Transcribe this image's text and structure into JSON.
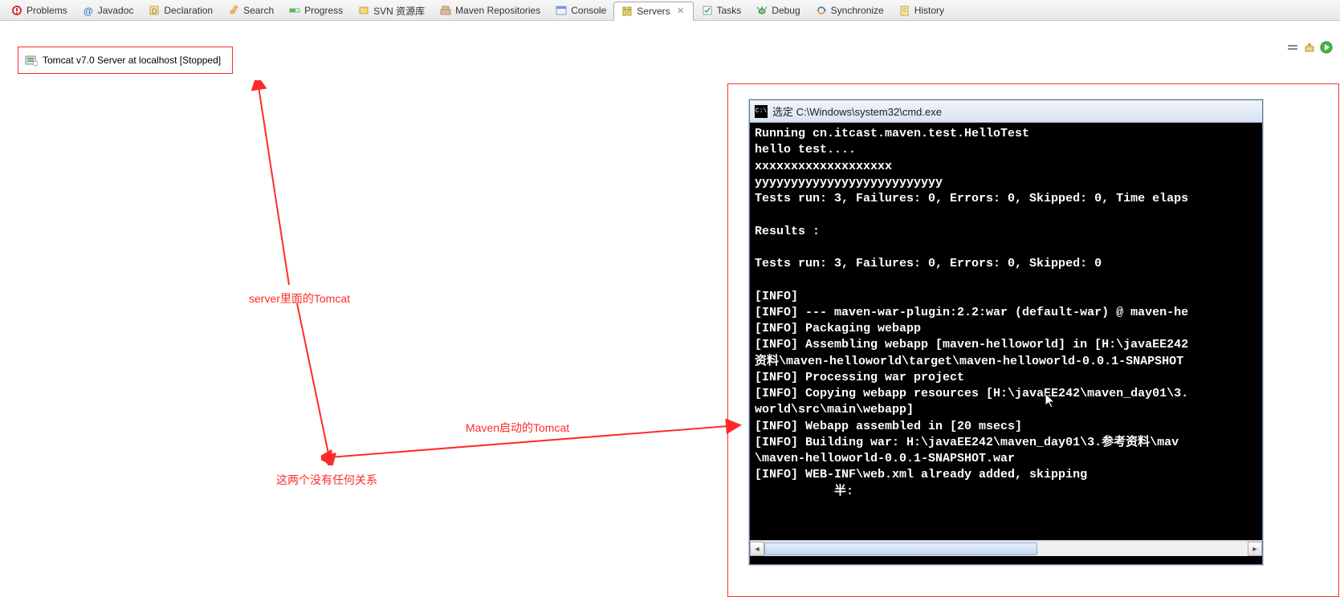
{
  "tabs": [
    {
      "label": "Problems",
      "icon": "problems-icon"
    },
    {
      "label": "Javadoc",
      "icon": "javadoc-icon"
    },
    {
      "label": "Declaration",
      "icon": "declaration-icon"
    },
    {
      "label": "Search",
      "icon": "search-icon"
    },
    {
      "label": "Progress",
      "icon": "progress-icon"
    },
    {
      "label": "SVN 资源库",
      "icon": "svn-icon"
    },
    {
      "label": "Maven Repositories",
      "icon": "maven-repo-icon"
    },
    {
      "label": "Console",
      "icon": "console-icon"
    },
    {
      "label": "Servers",
      "icon": "servers-icon",
      "active": true,
      "closable": true
    },
    {
      "label": "Tasks",
      "icon": "tasks-icon"
    },
    {
      "label": "Debug",
      "icon": "debug-icon"
    },
    {
      "label": "Synchronize",
      "icon": "synchronize-icon"
    },
    {
      "label": "History",
      "icon": "history-icon"
    }
  ],
  "server_item": "Tomcat v7.0 Server at localhost  [Stopped]",
  "annotations": {
    "a1": "server里面的Tomcat",
    "a2": "Maven启动的Tomcat",
    "a3": "这两个没有任何关系"
  },
  "cmd": {
    "title": "选定 C:\\Windows\\system32\\cmd.exe",
    "icon_text": "C:\\",
    "lines": [
      "Running cn.itcast.maven.test.HelloTest",
      "hello test....",
      "xxxxxxxxxxxxxxxxxxx",
      "yyyyyyyyyyyyyyyyyyyyyyyyyy",
      "Tests run: 3, Failures: 0, Errors: 0, Skipped: 0, Time elaps",
      "",
      "Results :",
      "",
      "Tests run: 3, Failures: 0, Errors: 0, Skipped: 0",
      "",
      "[INFO]",
      "[INFO] --- maven-war-plugin:2.2:war (default-war) @ maven-he",
      "[INFO] Packaging webapp",
      "[INFO] Assembling webapp [maven-helloworld] in [H:\\javaEE242",
      "资料\\maven-helloworld\\target\\maven-helloworld-0.0.1-SNAPSHOT",
      "[INFO] Processing war project",
      "[INFO] Copying webapp resources [H:\\javaEE242\\maven_day01\\3.",
      "world\\src\\main\\webapp]",
      "[INFO] Webapp assembled in [20 msecs]",
      "[INFO] Building war: H:\\javaEE242\\maven_day01\\3.参考资料\\mav",
      "\\maven-helloworld-0.0.1-SNAPSHOT.war",
      "[INFO] WEB-INF\\web.xml already added, skipping",
      "           半:"
    ]
  }
}
